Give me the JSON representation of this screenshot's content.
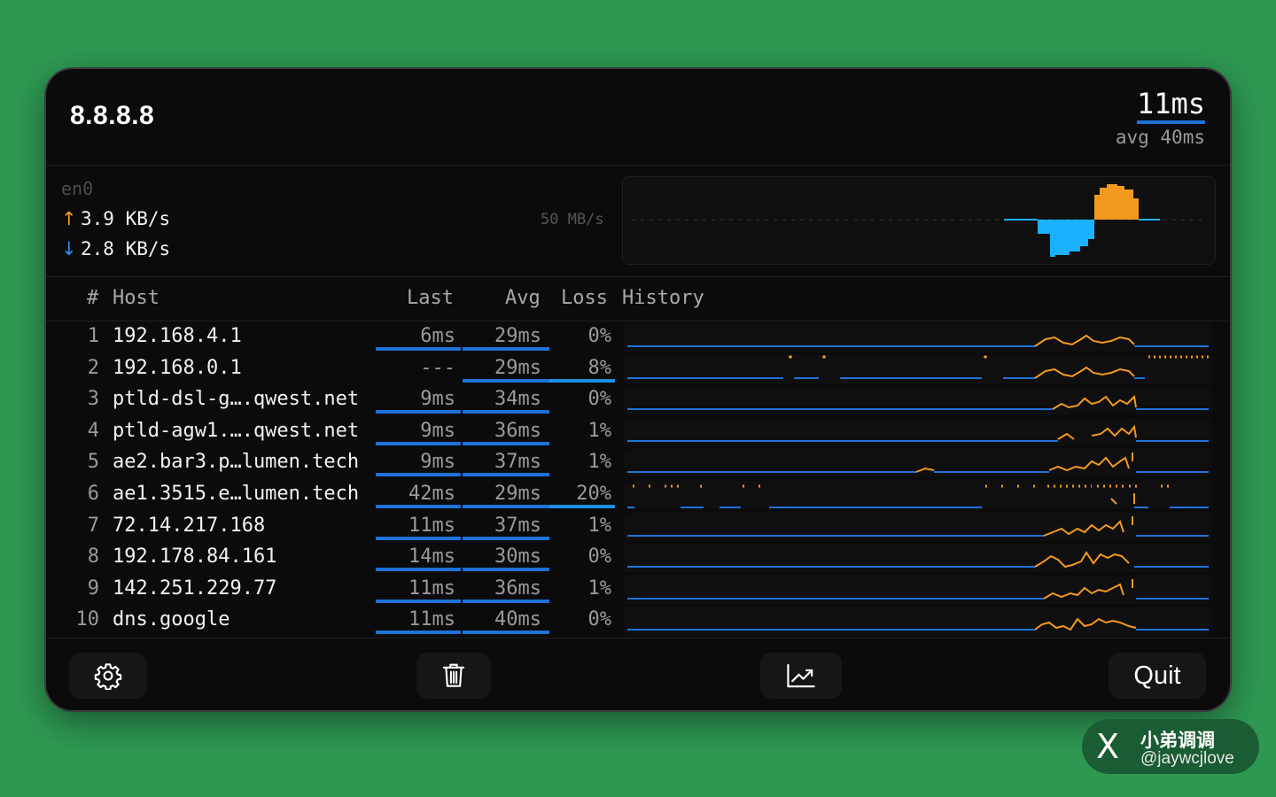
{
  "header": {
    "host": "8.8.8.8",
    "latency": "11ms",
    "avg": "avg 40ms"
  },
  "network": {
    "interface": "en0",
    "up_arrow": "↑",
    "down_arrow": "↓",
    "upload": "3.9 KB/s",
    "download": "2.8 KB/s",
    "scale": "50 MB/s",
    "upload_color": "#f39a1e",
    "download_color": "#1ab2ff"
  },
  "table": {
    "headers": {
      "index": "#",
      "host": "Host",
      "last": "Last",
      "avg": "Avg",
      "loss": "Loss",
      "history": "History"
    },
    "rows": [
      {
        "idx": "1",
        "host": "192.168.4.1",
        "last": "6ms",
        "avg": "29ms",
        "loss": "0%"
      },
      {
        "idx": "2",
        "host": "192.168.0.1",
        "last": "---",
        "avg": "29ms",
        "loss": "8%"
      },
      {
        "idx": "3",
        "host": "ptld-dsl-g….qwest.net",
        "last": "9ms",
        "avg": "34ms",
        "loss": "0%"
      },
      {
        "idx": "4",
        "host": "ptld-agw1.….qwest.net",
        "last": "9ms",
        "avg": "36ms",
        "loss": "1%"
      },
      {
        "idx": "5",
        "host": "ae2.bar3.p…lumen.tech",
        "last": "9ms",
        "avg": "37ms",
        "loss": "1%"
      },
      {
        "idx": "6",
        "host": "ae1.3515.e…lumen.tech",
        "last": "42ms",
        "avg": "29ms",
        "loss": "20%"
      },
      {
        "idx": "7",
        "host": "72.14.217.168",
        "last": "11ms",
        "avg": "37ms",
        "loss": "1%"
      },
      {
        "idx": "8",
        "host": "192.178.84.161",
        "last": "14ms",
        "avg": "30ms",
        "loss": "0%"
      },
      {
        "idx": "9",
        "host": "142.251.229.77",
        "last": "11ms",
        "avg": "36ms",
        "loss": "1%"
      },
      {
        "idx": "10",
        "host": "dns.google",
        "last": "11ms",
        "avg": "40ms",
        "loss": "0%"
      }
    ]
  },
  "footer": {
    "settings_icon": "gear-icon",
    "clear_icon": "trash-icon",
    "chart_icon": "chart-icon",
    "quit": "Quit"
  },
  "colors": {
    "accent_blue": "#1e72d8",
    "history_orange": "#f39a1e",
    "background": "#2e9852"
  },
  "watermark": {
    "logo": "X",
    "name": "小弟调调",
    "handle": "@jaywcjlove"
  }
}
